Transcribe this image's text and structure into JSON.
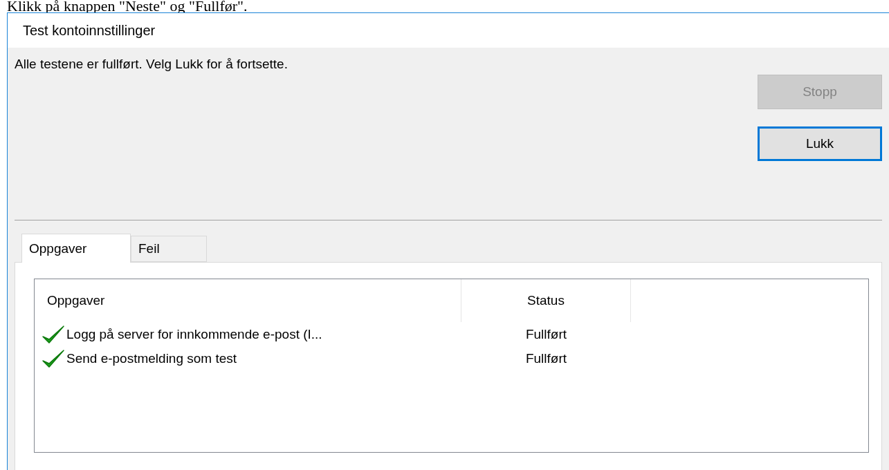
{
  "instruction": "Klikk på knappen \"Neste\" og \"Fullfør\".",
  "window": {
    "title": "Test kontoinnstillinger"
  },
  "message": "Alle testene er fullført. Velg Lukk for å fortsette.",
  "buttons": [
    {
      "label": "Stopp",
      "disabled": true,
      "focused": false
    },
    {
      "label": "Lukk",
      "disabled": false,
      "focused": true
    }
  ],
  "tabs": [
    {
      "label": "Oppgaver",
      "selected": true
    },
    {
      "label": "Feil",
      "selected": false
    }
  ],
  "table": {
    "columns": [
      "Oppgaver",
      "Status"
    ],
    "rows": [
      {
        "task": "Logg på server for innkommende e-post (I...",
        "status": "Fullført",
        "done": true
      },
      {
        "task": "Send e-postmelding som test",
        "status": "Fullført",
        "done": true
      }
    ]
  }
}
